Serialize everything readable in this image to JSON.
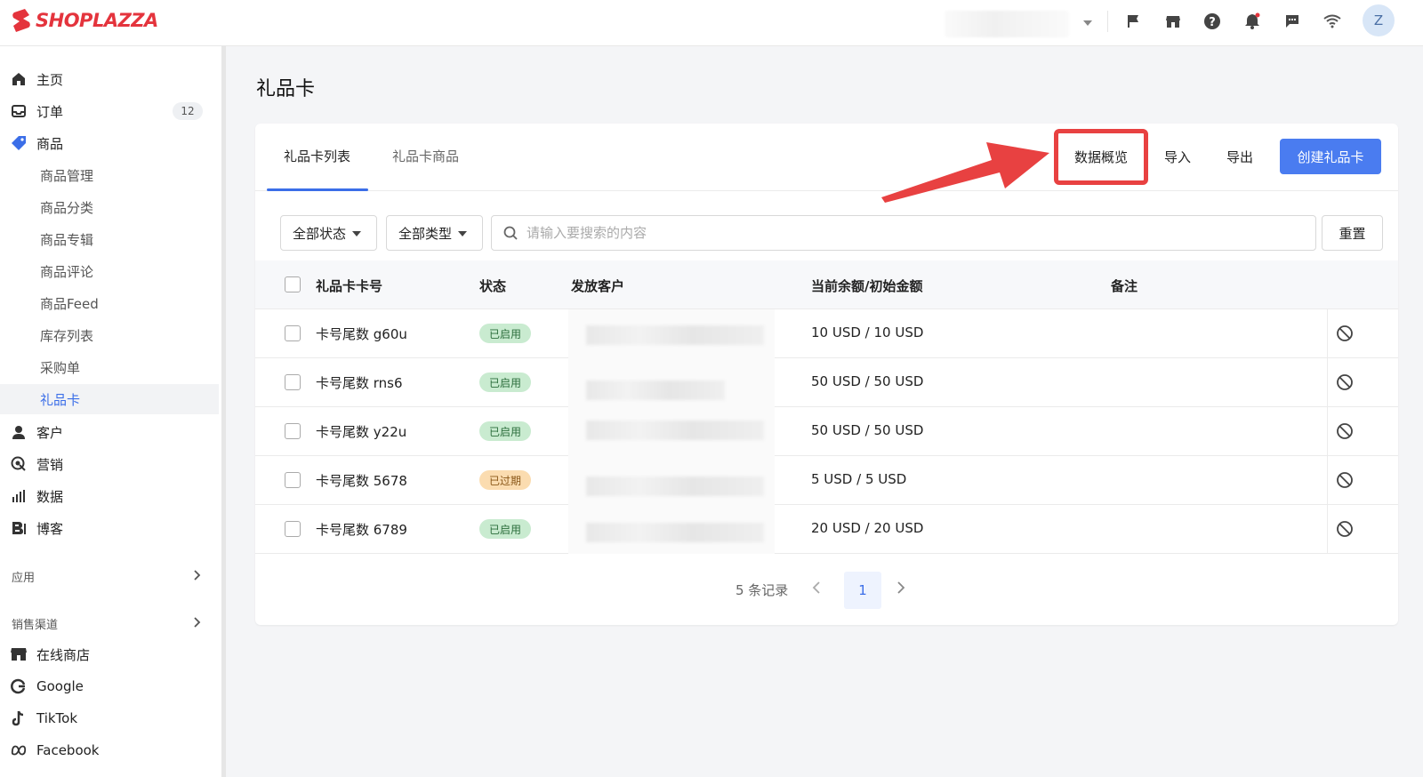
{
  "brand": {
    "name": "SHOPLAZZA",
    "color": "#e4343d"
  },
  "topbar": {
    "icons": [
      "flag-icon",
      "store-icon",
      "help-icon",
      "notification-icon",
      "chat-icon",
      "wifi-icon"
    ],
    "avatar_initial": "Z"
  },
  "sidebar": {
    "main_items": [
      {
        "label": "主页",
        "icon": "home-icon"
      },
      {
        "label": "订单",
        "icon": "inbox-icon",
        "badge": "12"
      },
      {
        "label": "商品",
        "icon": "tag-icon"
      }
    ],
    "product_sub": [
      "商品管理",
      "商品分类",
      "商品专辑",
      "商品评论",
      "商品Feed",
      "库存列表",
      "采购单",
      "礼品卡"
    ],
    "active_sub": "礼品卡",
    "other_items": [
      {
        "label": "客户",
        "icon": "user-icon"
      },
      {
        "label": "营销",
        "icon": "marketing-icon"
      },
      {
        "label": "数据",
        "icon": "chart-icon"
      },
      {
        "label": "博客",
        "icon": "blog-icon"
      }
    ],
    "apps_header": "应用",
    "channels_header": "销售渠道",
    "channels": [
      {
        "label": "在线商店",
        "icon": "store-icon"
      },
      {
        "label": "Google",
        "icon": "google-icon"
      },
      {
        "label": "TikTok",
        "icon": "tiktok-icon"
      },
      {
        "label": "Facebook",
        "icon": "meta-icon"
      }
    ]
  },
  "page": {
    "title": "礼品卡",
    "tabs": [
      "礼品卡列表",
      "礼品卡商品"
    ],
    "actions": {
      "overview": "数据概览",
      "import": "导入",
      "export": "导出",
      "create": "创建礼品卡"
    },
    "filters": {
      "status": "全部状态",
      "type": "全部类型",
      "search_placeholder": "请输入要搜索的内容",
      "reset": "重置"
    },
    "columns": [
      "礼品卡卡号",
      "状态",
      "发放客户",
      "当前余额/初始金额",
      "备注"
    ],
    "rows": [
      {
        "card": "卡号尾数 g60u",
        "status": "已启用",
        "status_kind": "on",
        "balance": "10 USD / 10 USD"
      },
      {
        "card": "卡号尾数 rns6",
        "status": "已启用",
        "status_kind": "on",
        "balance": "50 USD / 50 USD"
      },
      {
        "card": "卡号尾数 y22u",
        "status": "已启用",
        "status_kind": "on",
        "balance": "50 USD / 50 USD"
      },
      {
        "card": "卡号尾数 5678",
        "status": "已过期",
        "status_kind": "exp",
        "balance": "5 USD / 5 USD"
      },
      {
        "card": "卡号尾数 6789",
        "status": "已启用",
        "status_kind": "on",
        "balance": "20 USD / 20 USD"
      }
    ],
    "pagination": {
      "total": "5 条记录",
      "current": "1"
    }
  },
  "colors": {
    "accent": "#4a7cf0",
    "highlight": "#e84141",
    "enabled": "#c9ebd0",
    "expired": "#fbdcb0"
  }
}
